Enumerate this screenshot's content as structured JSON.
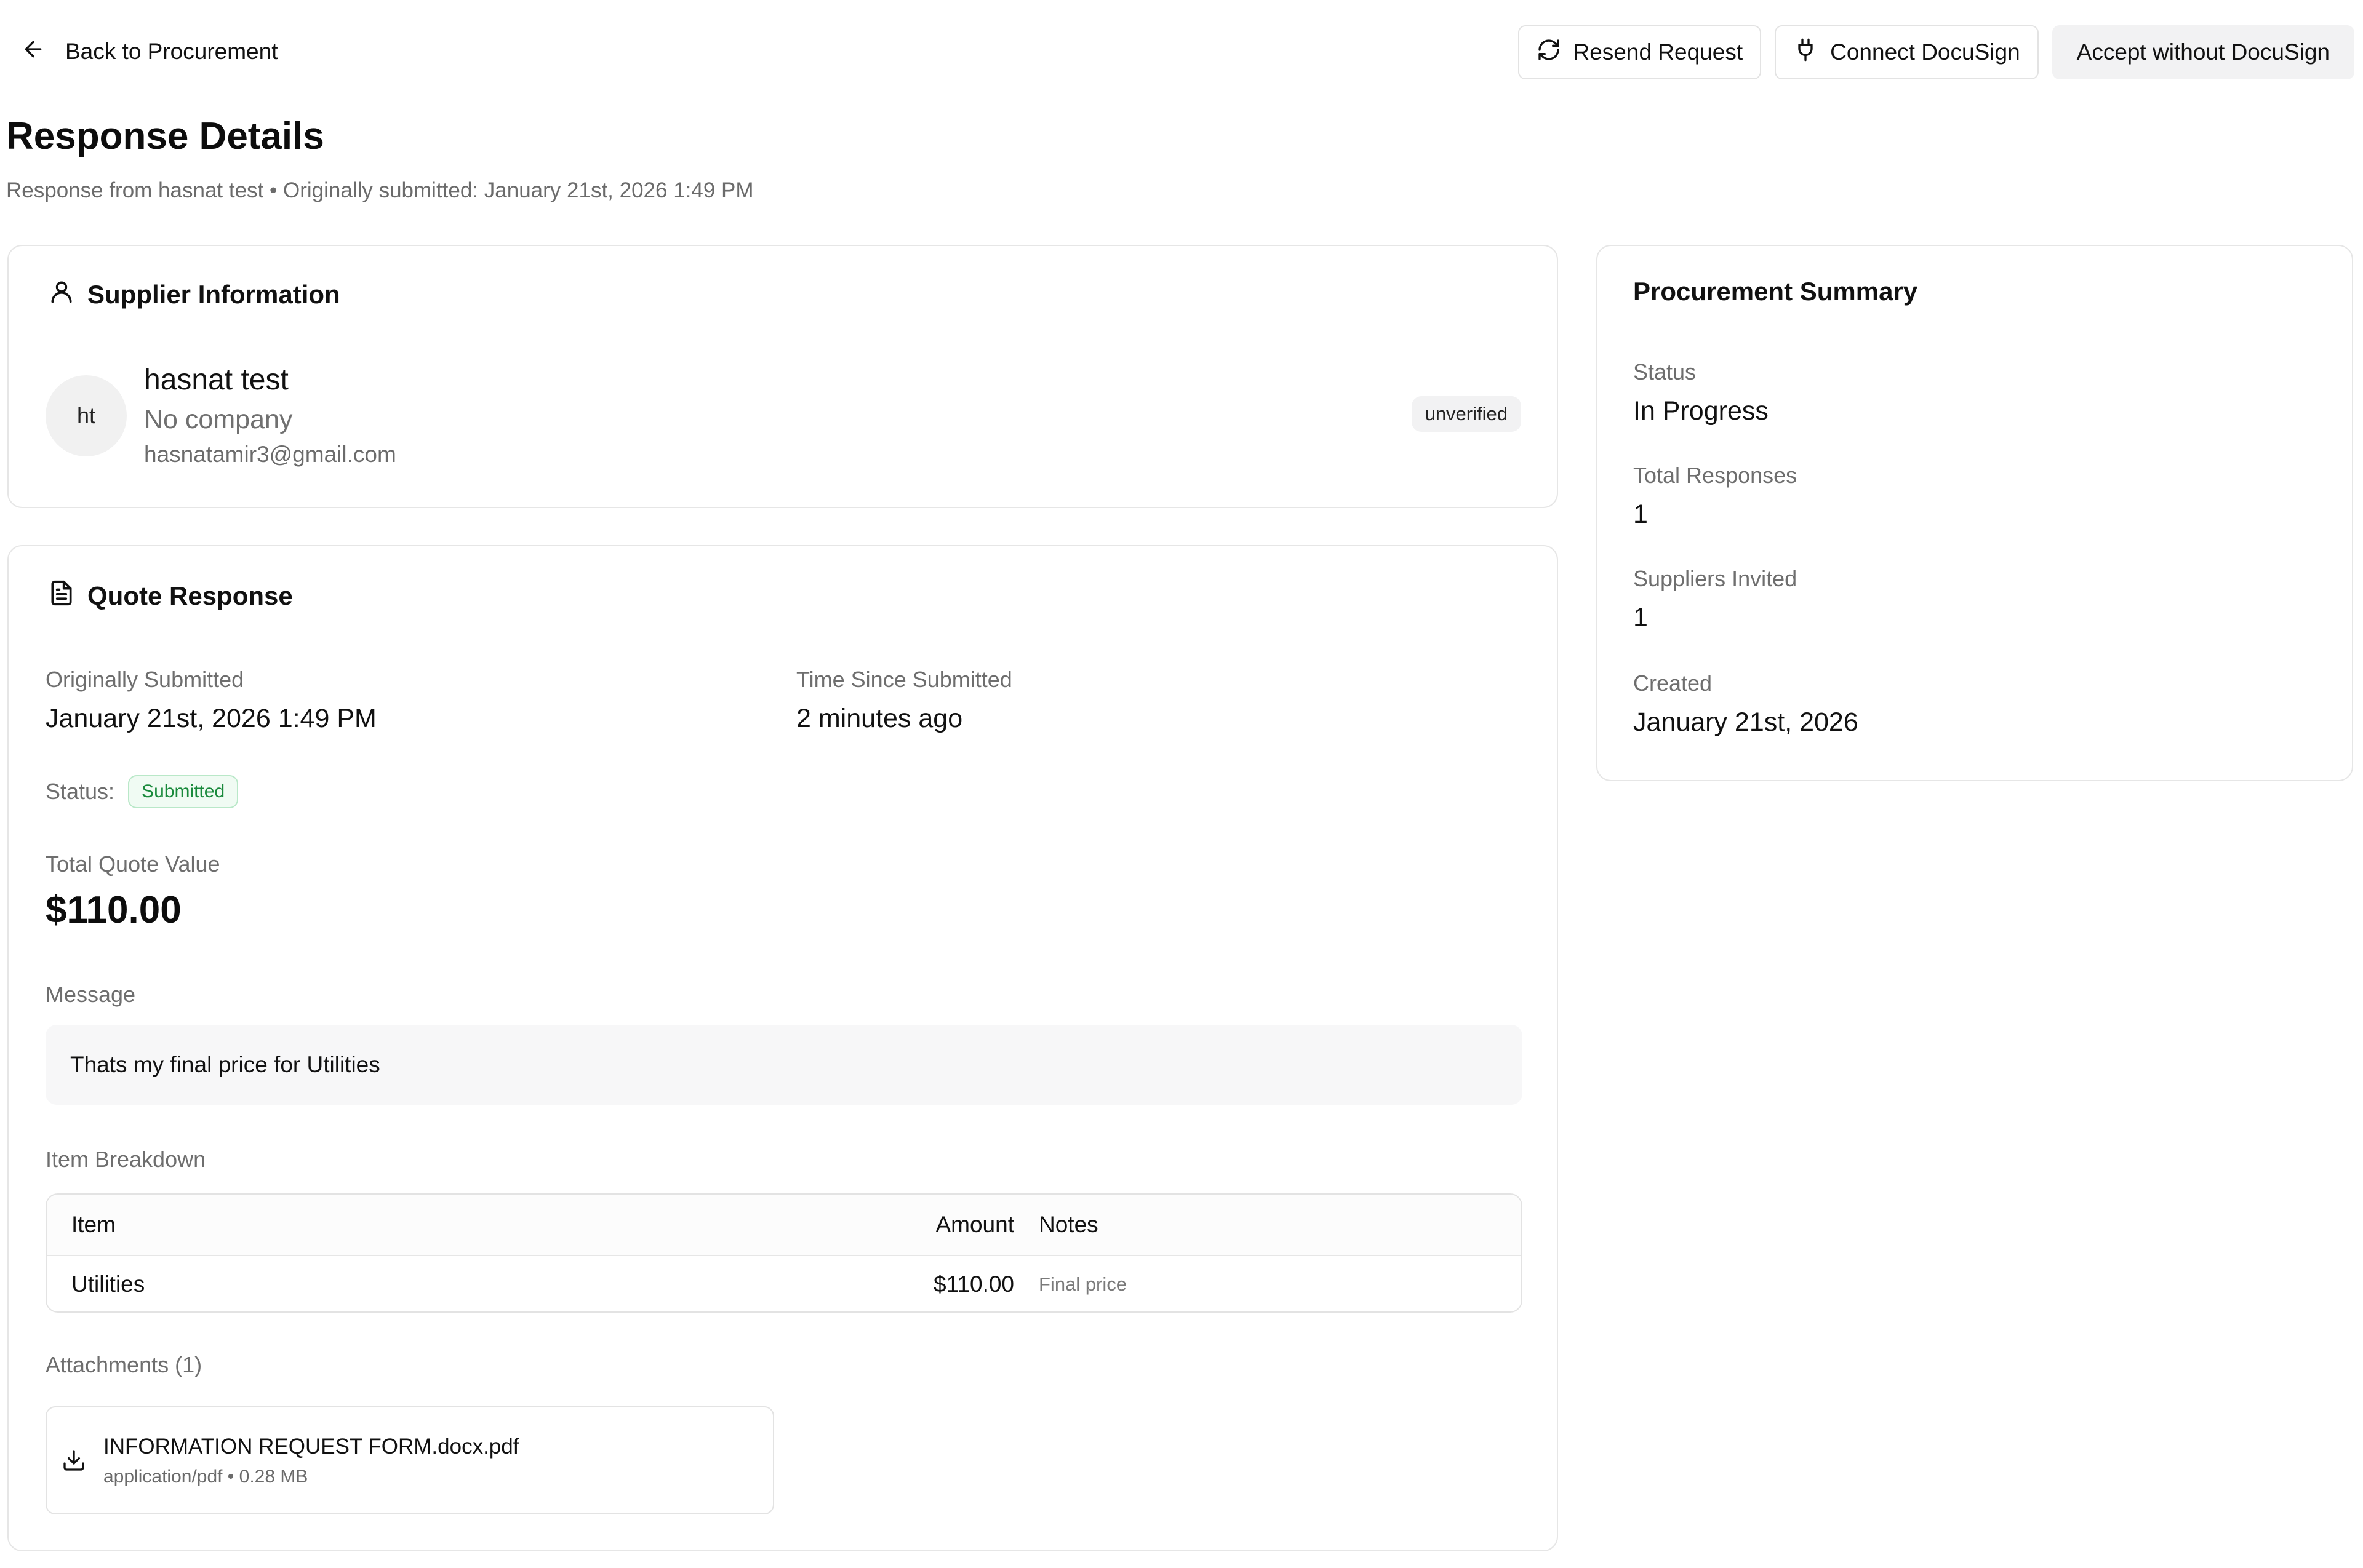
{
  "top_bar": {
    "back_label": "Back to Procurement",
    "resend_label": "Resend Request",
    "connect_label": "Connect DocuSign",
    "accept_label": "Accept without DocuSign"
  },
  "page": {
    "title": "Response Details",
    "subtitle": "Response from hasnat test • Originally submitted: January 21st, 2026 1:49 PM"
  },
  "supplier": {
    "header": "Supplier Information",
    "initials": "ht",
    "name": "hasnat test",
    "company": "No company",
    "email": "hasnatamir3@gmail.com",
    "badge": "unverified"
  },
  "quote": {
    "header": "Quote Response",
    "submitted_label": "Originally Submitted",
    "submitted_value": "January 21st, 2026 1:49 PM",
    "since_label": "Time Since Submitted",
    "since_value": "2 minutes ago",
    "status_label": "Status:",
    "status_value": "Submitted",
    "total_label": "Total Quote Value",
    "total_value": "$110.00",
    "message_label": "Message",
    "message_value": "Thats my final price for Utilities",
    "breakdown_label": "Item Breakdown",
    "table": {
      "headers": {
        "item": "Item",
        "amount": "Amount",
        "notes": "Notes"
      },
      "rows": [
        {
          "item": "Utilities",
          "amount": "$110.00",
          "notes": "Final price"
        }
      ]
    },
    "attachments_label": "Attachments (1)",
    "attachments": [
      {
        "name": "INFORMATION REQUEST FORM.docx.pdf",
        "meta": "application/pdf • 0.28 MB"
      }
    ]
  },
  "summary": {
    "header": "Procurement Summary",
    "status_label": "Status",
    "status_value": "In Progress",
    "responses_label": "Total Responses",
    "responses_value": "1",
    "invited_label": "Suppliers Invited",
    "invited_value": "1",
    "created_label": "Created",
    "created_value": "January 21st, 2026"
  },
  "icons": {
    "back": "arrow-left-icon",
    "resend": "refresh-icon",
    "connect": "plug-icon",
    "supplier": "user-icon",
    "quote": "file-text-icon",
    "attachment": "download-icon"
  }
}
